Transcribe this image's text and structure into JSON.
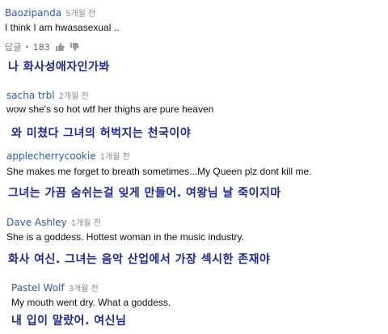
{
  "comments": [
    {
      "author": "Baozipanda",
      "time": "5개월 전",
      "text": "I think I am hwasasexual ..",
      "reply_label": "답글",
      "likes": "183",
      "translation": "나 화사성애자인가봐"
    },
    {
      "author": "sacha trbl",
      "time": "2개월 전",
      "text": "wow she's so hot wtf her thighs are pure heaven",
      "translation": "와 미쳤다 그녀의 허벅지는 천국이야"
    },
    {
      "author": "applecherrycookie",
      "time": "1개월 전",
      "text": "She makes me forget to breath sometimes...My Queen plz dont kill me.",
      "translation": "그녀는 가끔 숨쉬는걸 잊게 만들어. 여왕님 날 죽이지마"
    },
    {
      "author": "Dave Ashley",
      "time": "1개월 전",
      "text": "She is a goddess.  Hottest woman in the music industry.",
      "translation": "화사 여신. 그녀는 음악 산업에서 가장 섹시한 존재야"
    },
    {
      "author": "Pastel Wolf",
      "time": "3개월 전",
      "text": "My mouth went dry. What a goddess.",
      "translation": "내 입이 말랐어. 여신님"
    }
  ],
  "colors": {
    "author": "#2e5aa8",
    "time": "#8a8a8a",
    "translation": "#1b2a8a"
  },
  "icons": [
    "thumb-up-icon",
    "thumb-down-icon"
  ]
}
